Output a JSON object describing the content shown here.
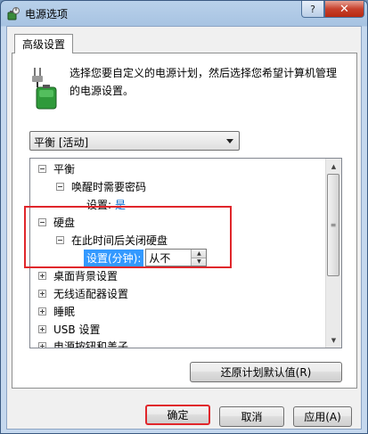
{
  "window": {
    "title": "电源选项",
    "help_label": "?",
    "close_label": "✕"
  },
  "tab": {
    "label": "高级设置"
  },
  "description": "选择您要自定义的电源计划，然后选择您希望计算机管理的电源设置。",
  "plan_select": {
    "value": "平衡 [活动]"
  },
  "tree": {
    "items": [
      {
        "label": "平衡"
      },
      {
        "label": "唤醒时需要密码"
      },
      {
        "label": "设置:",
        "value": "是"
      },
      {
        "label": "硬盘"
      },
      {
        "label": "在此时间后关闭硬盘"
      },
      {
        "label": "设置(分钟):",
        "value": "从不"
      },
      {
        "label": "桌面背景设置"
      },
      {
        "label": "无线适配器设置"
      },
      {
        "label": "睡眠"
      },
      {
        "label": "USB 设置"
      },
      {
        "label": "电源按钮和盖子"
      }
    ]
  },
  "buttons": {
    "restore": "还原计划默认值(R)",
    "ok": "确定",
    "cancel": "取消",
    "apply": "应用(A)"
  },
  "colors": {
    "highlight": "#e0262b",
    "selection": "#3399ff",
    "link": "#0066cc"
  }
}
